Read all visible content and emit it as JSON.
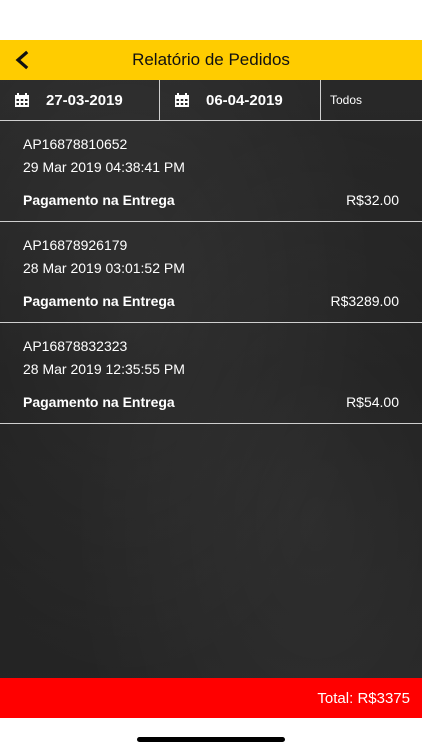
{
  "header": {
    "title": "Relatório de Pedidos"
  },
  "filters": {
    "start_date": "27-03-2019",
    "end_date": "06-04-2019",
    "status": "Todos"
  },
  "orders": [
    {
      "code": "AP16878810652",
      "date": "29 Mar 2019 04:38:41 PM",
      "payment": "Pagamento na Entrega",
      "total": "R$32.00"
    },
    {
      "code": "AP16878926179",
      "date": "28 Mar 2019 03:01:52 PM",
      "payment": "Pagamento na Entrega",
      "total": "R$3289.00"
    },
    {
      "code": "AP16878832323",
      "date": "28 Mar 2019 12:35:55 PM",
      "payment": "Pagamento na Entrega",
      "total": "R$54.00"
    }
  ],
  "footer": {
    "total_label": "Total: R$3375"
  },
  "colors": {
    "header_bg": "#ffcc00",
    "footer_bg": "#ff0000",
    "text": "#ffffff"
  },
  "icons": {
    "back": "chevron-left-icon",
    "calendar": "calendar-icon"
  }
}
